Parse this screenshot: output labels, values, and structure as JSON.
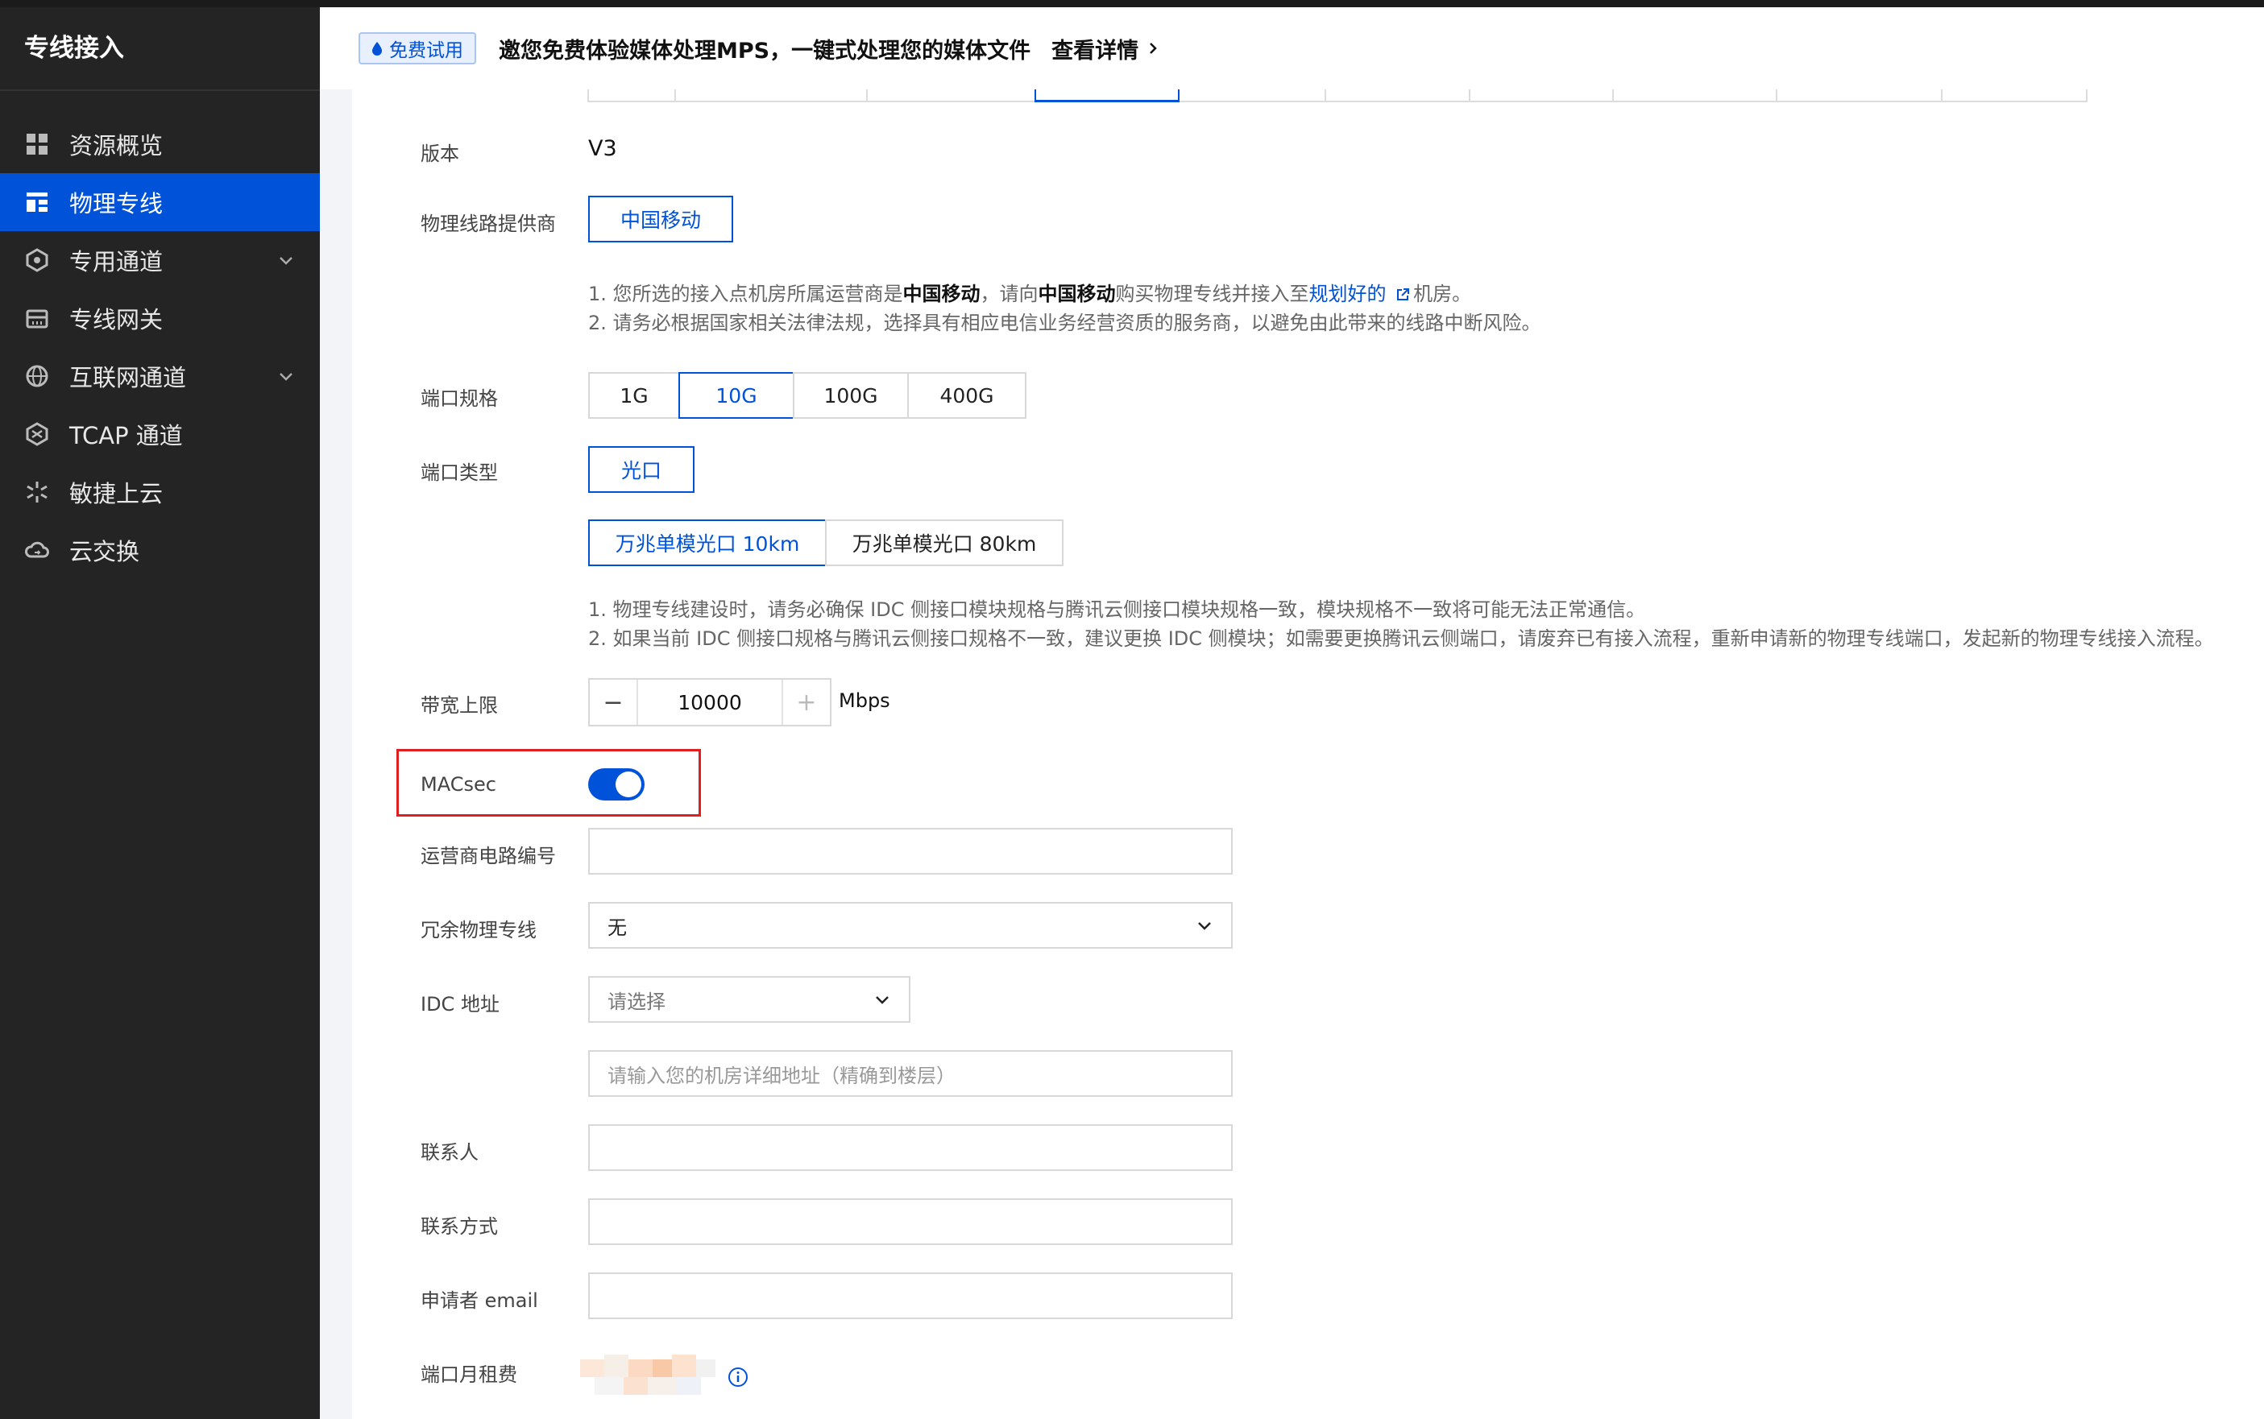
{
  "sidebar": {
    "title": "专线接入",
    "items": [
      {
        "label": "资源概览",
        "icon": "grid-icon"
      },
      {
        "label": "物理专线",
        "icon": "dedicated-line-icon",
        "active": true
      },
      {
        "label": "专用通道",
        "icon": "cube-icon",
        "expandable": true
      },
      {
        "label": "专线网关",
        "icon": "gateway-icon"
      },
      {
        "label": "互联网通道",
        "icon": "globe-icon",
        "expandable": true
      },
      {
        "label": "TCAP 通道",
        "icon": "tcap-icon"
      },
      {
        "label": "敏捷上云",
        "icon": "asterisk-icon"
      },
      {
        "label": "云交换",
        "icon": "cloud-exchange-icon"
      }
    ]
  },
  "banner": {
    "badge": "免费试用",
    "text": "邀您免费体验媒体处理MPS，一键式处理您的媒体文件",
    "link": "查看详情"
  },
  "form": {
    "version_label": "版本",
    "version_value": "V3",
    "provider_label": "物理线路提供商",
    "provider_value": "中国移动",
    "provider_note": {
      "line1_a": "1. 您所选的接入点机房所属运营商是",
      "line1_b": "中国移动",
      "line1_c": "，请向",
      "line1_d": "中国移动",
      "line1_e": "购买物理专线并接入至",
      "line1_link": "规划好的",
      "line1_f": "机房。",
      "line2": "2. 请务必根据国家相关法律法规，选择具有相应电信业务经营资质的服务商，以避免由此带来的线路中断风险。"
    },
    "port_spec_label": "端口规格",
    "port_specs": [
      "1G",
      "10G",
      "100G",
      "400G"
    ],
    "port_spec_selected": "10G",
    "port_type_label": "端口类型",
    "port_type_value": "光口",
    "module_options": [
      "万兆单模光口 10km",
      "万兆单模光口 80km"
    ],
    "module_selected": "万兆单模光口 10km",
    "port_note": {
      "line1": "1. 物理专线建设时，请务必确保 IDC 侧接口模块规格与腾讯云侧接口模块规格一致，模块规格不一致将可能无法正常通信。",
      "line2": "2. 如果当前 IDC 侧接口规格与腾讯云侧接口规格不一致，建议更换 IDC 侧模块；如需要更换腾讯云侧端口，请废弃已有接入流程，重新申请新的物理专线端口，发起新的物理专线接入流程。"
    },
    "bandwidth_label": "带宽上限",
    "bandwidth_value": "10000",
    "bandwidth_minus": "−",
    "bandwidth_plus": "+",
    "bandwidth_unit": "Mbps",
    "macsec_label": "MACsec",
    "macsec_enabled": true,
    "circuit_label": "运营商电路编号",
    "circuit_value": "",
    "redundant_label": "冗余物理专线",
    "redundant_value": "无",
    "idc_label": "IDC 地址",
    "idc_select_placeholder": "请选择",
    "idc_address_placeholder": "请输入您的机房详细地址（精确到楼层）",
    "contact_label": "联系人",
    "contact_value": "",
    "phone_label": "联系方式",
    "phone_value": "",
    "email_label": "申请者 email",
    "email_value": "",
    "fee_label": "端口月租费"
  },
  "colors": {
    "primary": "#0052d9",
    "sidebar_bg": "#242424",
    "highlight_box": "#e02020"
  }
}
